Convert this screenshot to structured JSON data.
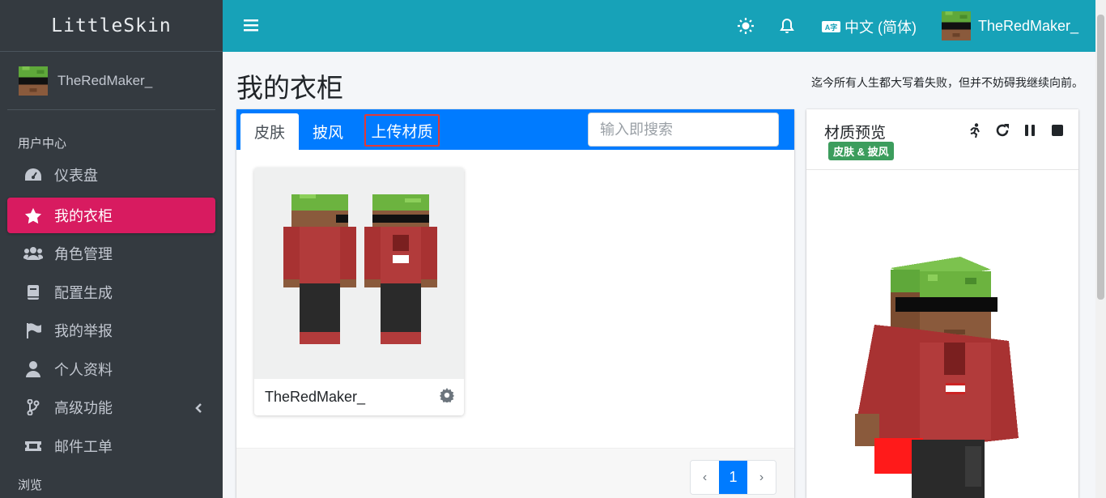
{
  "brand": "LittleSkin",
  "user": {
    "name": "TheRedMaker_"
  },
  "sidebar": {
    "header_user": "用户中心",
    "items": [
      {
        "label": "仪表盘",
        "icon": "tachometer-icon"
      },
      {
        "label": "我的衣柜",
        "icon": "star-icon",
        "active": true
      },
      {
        "label": "角色管理",
        "icon": "users-icon"
      },
      {
        "label": "配置生成",
        "icon": "book-icon"
      },
      {
        "label": "我的举报",
        "icon": "flag-icon"
      },
      {
        "label": "个人资料",
        "icon": "user-icon"
      },
      {
        "label": "高级功能",
        "icon": "code-branch-icon"
      },
      {
        "label": "邮件工单",
        "icon": "ticket-icon"
      }
    ],
    "header_browse": "浏览"
  },
  "topbar": {
    "language_badge": "A字",
    "language": "中文 (简体)",
    "username": "TheRedMaker_"
  },
  "page": {
    "title": "我的衣柜",
    "motto": "迄今所有人生都大写着失败，但并不妨碍我继续向前。"
  },
  "closet": {
    "tabs": [
      "皮肤",
      "披风",
      "上传材质"
    ],
    "search_placeholder": "输入即搜索",
    "items": [
      {
        "name": "TheRedMaker_"
      }
    ],
    "pagination": {
      "prev": "‹",
      "current": "1",
      "next": "›"
    }
  },
  "preview": {
    "title": "材质预览",
    "badge": "皮肤 & 披风"
  },
  "colors": {
    "sidebar_bg": "#343a40",
    "topbar_bg": "#17a2b8",
    "active_item": "#d81b60",
    "card_header": "#007bff",
    "badge_green": "#3c9d5d"
  }
}
